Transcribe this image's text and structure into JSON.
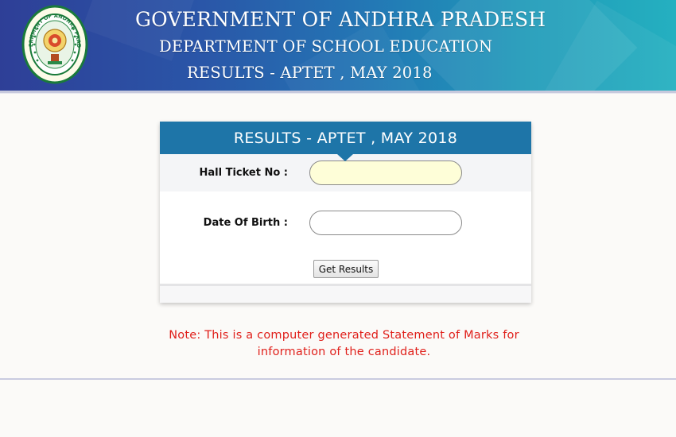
{
  "header": {
    "title_line1": "GOVERNMENT OF ANDHRA PRADESH",
    "title_line2": "DEPARTMENT OF SCHOOL EDUCATION",
    "title_line3": "RESULTS - APTET , MAY 2018",
    "emblem_icon": "andhra-pradesh-emblem-icon",
    "emblem_ring_text": "GOVERNMENT OF ANDHRA PRADESH",
    "colors": {
      "banner_start": "#2e3f97",
      "banner_end": "#25b0c0"
    }
  },
  "form": {
    "title": "RESULTS - APTET , MAY 2018",
    "hall_ticket_label": "Hall Ticket No :",
    "hall_ticket_value": "",
    "dob_label": "Date Of Birth :",
    "dob_value": "",
    "submit_label": "Get Results",
    "colors": {
      "header_bg": "#1e75a8",
      "active_input_bg": "#fefed8"
    }
  },
  "note": {
    "line1": "Note: This is a computer generated Statement of Marks for",
    "line2": "information of the candidate.",
    "color": "#e0201b"
  }
}
